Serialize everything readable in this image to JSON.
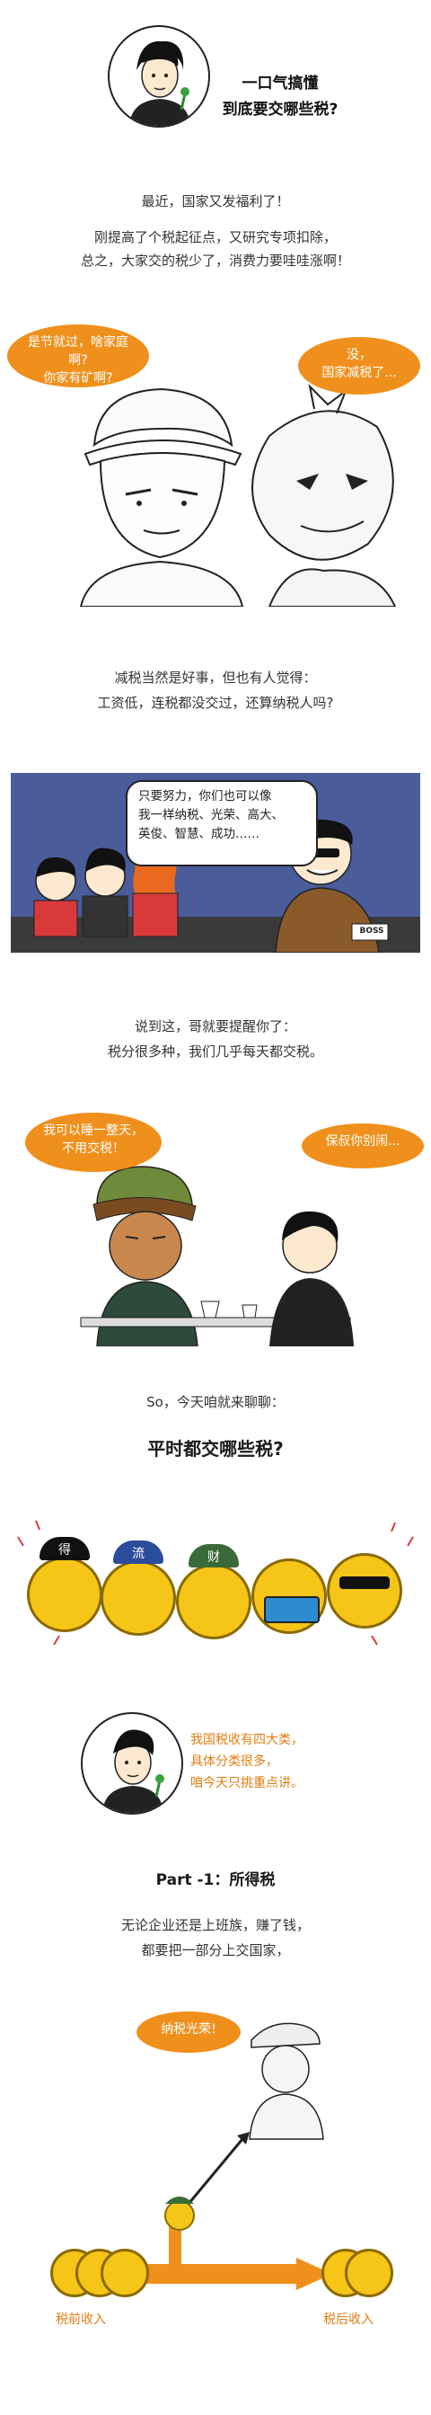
{
  "header": {
    "title_line1": "一口气搞懂",
    "title_line2": "到底要交哪些税?"
  },
  "intro": {
    "line1": "最近，国家又发福利了！",
    "line2": "刚提高了个税起征点，又研究专项扣除，",
    "line3": "总之，大家交的税少了，消费力要哇哇涨啊！"
  },
  "comic1": {
    "bubble_left": "是节就过，啥家庭啊?\n你家有矿啊?",
    "bubble_right": "没，\n国家减税了..."
  },
  "para2": {
    "line1": "减税当然是好事，但也有人觉得：",
    "line2": "工资低，连税都没交过，还算纳税人吗?"
  },
  "comic2": {
    "speech": "只要努力，你们也可以像\n我一样纳税、光荣、高大、\n英俊、智慧、成功……",
    "sign": "BOSS"
  },
  "para3": {
    "line1": "说到这，哥就要提醒你了：",
    "line2": "税分很多种，我们几乎每天都交税。"
  },
  "comic3": {
    "bubble_left": "我可以睡一整天，\n不用交税！",
    "bubble_right": "保叔你别闹..."
  },
  "para4": {
    "line1": "So，今天咱就来聊聊：",
    "heading": "平时都交哪些税?"
  },
  "coins": {
    "hat_labels": [
      "得",
      "流",
      "财",
      "",
      ""
    ]
  },
  "note": {
    "line1": "我国税收有四大类，",
    "line2": "具体分类很多，",
    "line3": "咱今天只挑重点讲。"
  },
  "part1": {
    "heading": "Part -1：所得税",
    "line1": "无论企业还是上班族，赚了钱，",
    "line2": "都要把一部分上交国家，",
    "bubble": "纳税光荣!",
    "label_before": "税前收入",
    "label_after": "税后收入"
  },
  "colors": {
    "accent": "#f0901c",
    "coin": "#f5c518",
    "text": "#333333"
  }
}
